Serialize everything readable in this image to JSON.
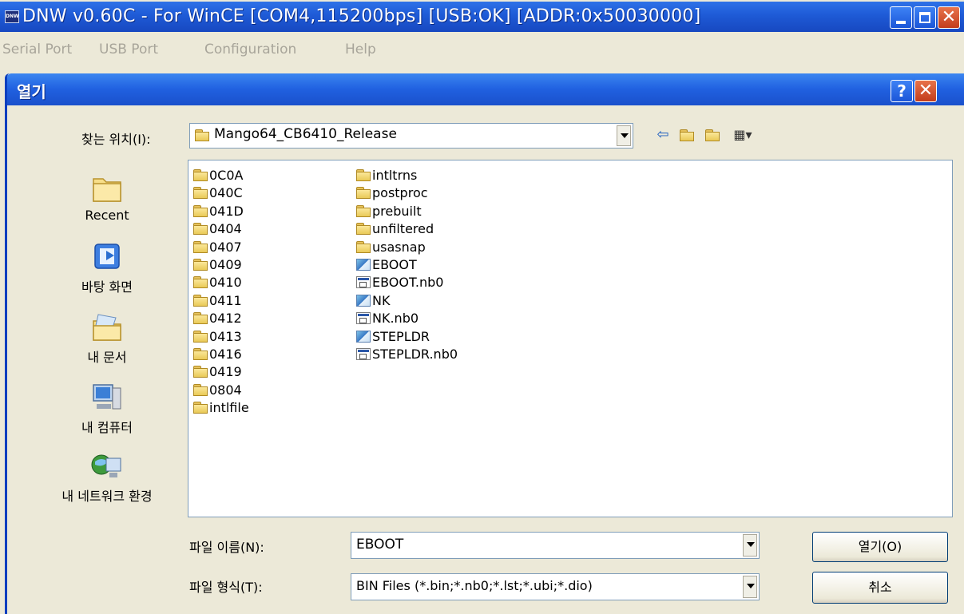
{
  "main_window": {
    "title": "DNW v0.60C - For WinCE  [COM4,115200bps] [USB:OK] [ADDR:0x50030000]",
    "icon_label": "DNW",
    "menu": [
      "Serial Port",
      "USB Port",
      "Configuration",
      "Help"
    ]
  },
  "dialog": {
    "title": "열기",
    "help_label": "?",
    "look_in_label": "찾는 위치(I):",
    "look_in_value": "Mango64_CB6410_Release",
    "places": [
      {
        "label": "Recent",
        "icon": "recent-folder-icon"
      },
      {
        "label": "바탕 화면",
        "icon": "desktop-icon"
      },
      {
        "label": "내 문서",
        "icon": "my-documents-icon"
      },
      {
        "label": "내 컴퓨터",
        "icon": "my-computer-icon"
      },
      {
        "label": "내 네트워크 환경",
        "icon": "network-icon"
      }
    ],
    "files_col1": [
      "0C0A",
      "040C",
      "041D",
      "0404",
      "0407",
      "0409",
      "0410",
      "0411",
      "0412",
      "0413",
      "0416",
      "0419",
      "0804",
      "intlfile"
    ],
    "files_col2": [
      {
        "name": "intltrns",
        "type": "folder"
      },
      {
        "name": "postproc",
        "type": "folder"
      },
      {
        "name": "prebuilt",
        "type": "folder"
      },
      {
        "name": "unfiltered",
        "type": "folder"
      },
      {
        "name": "usasnap",
        "type": "folder"
      },
      {
        "name": "EBOOT",
        "type": "exe"
      },
      {
        "name": "EBOOT.nb0",
        "type": "bin"
      },
      {
        "name": "NK",
        "type": "exe"
      },
      {
        "name": "NK.nb0",
        "type": "bin"
      },
      {
        "name": "STEPLDR",
        "type": "exe"
      },
      {
        "name": "STEPLDR.nb0",
        "type": "bin"
      }
    ],
    "filename_label": "파일 이름(N):",
    "filename_value": "EBOOT",
    "filetype_label": "파일 형식(T):",
    "filetype_value": "BIN Files (*.bin;*.nb0;*.lst;*.ubi;*.dio)",
    "open_button": "열기(O)",
    "cancel_button": "취소"
  }
}
